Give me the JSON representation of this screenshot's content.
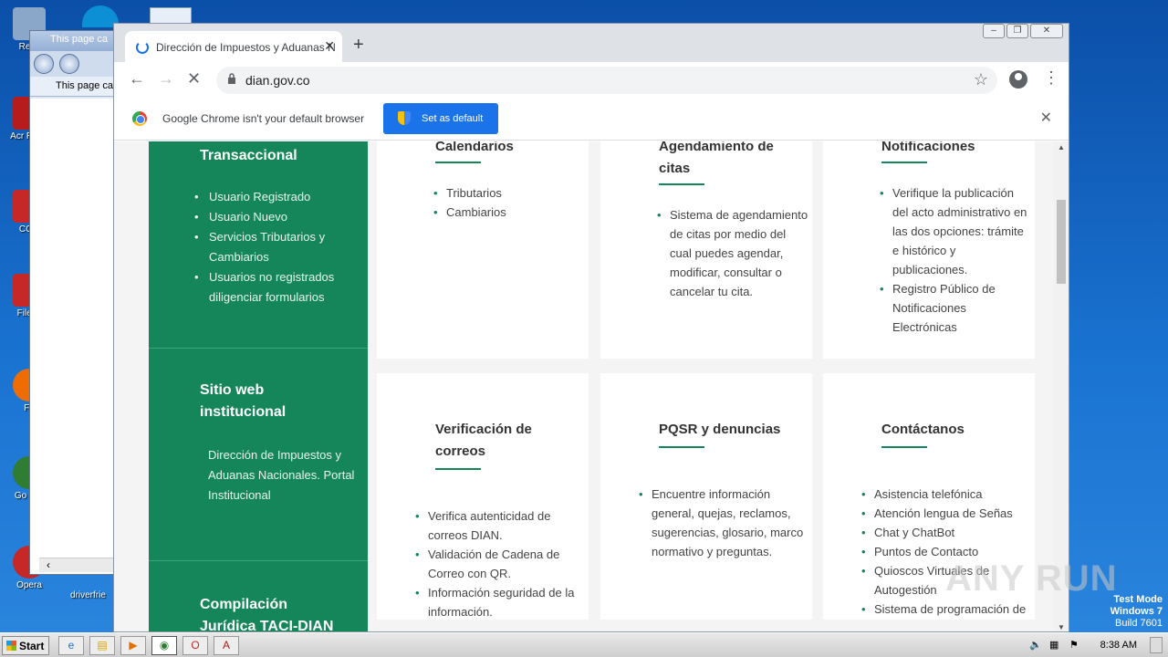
{
  "desktop": {
    "icons": [
      {
        "label": "Recy",
        "color": "#8aa7c9"
      },
      {
        "label": "Acr Read",
        "color": "#b71c1c"
      },
      {
        "label": "CCle",
        "color": "#c62828"
      },
      {
        "label": "FileZil",
        "color": "#c62828"
      },
      {
        "label": "Fir",
        "color": "#ef6c00"
      },
      {
        "label": "Go Chr",
        "color": "#2e7d32"
      },
      {
        "label": "Opera",
        "color": "#c62828"
      }
    ],
    "driver_label": "driverfrie"
  },
  "ie_window": {
    "title": "This page ca",
    "tab": "This page ca"
  },
  "chrome": {
    "tab_title": "Dirección de Impuestos y Aduanas N",
    "url": "dian.gov.co",
    "infobar_text": "Google Chrome isn't your default browser",
    "set_default_label": "Set as default"
  },
  "page": {
    "sections": [
      {
        "title": "Transaccional",
        "items": [
          "Usuario Registrado",
          "Usuario Nuevo",
          "Servicios Tributarios y",
          "Cambiarios",
          "Usuarios no registrados",
          "diligenciar formularios"
        ]
      },
      {
        "title_lines": [
          "Sitio web",
          "institucional"
        ],
        "text": [
          "Dirección de Impuestos y",
          "Aduanas Nacionales. Portal",
          "Institucional"
        ]
      },
      {
        "title_lines": [
          "Compilación",
          "Jurídica TACI-DIAN"
        ]
      }
    ],
    "cards_row1": [
      {
        "title": "Calendarios",
        "items": [
          "Tributarios",
          "Cambiarios"
        ]
      },
      {
        "title_lines": [
          "Agendamiento de",
          "citas"
        ],
        "items": [
          "Sistema de agendamiento de citas por medio del cual puedes agendar, modificar, consultar o cancelar tu cita."
        ]
      },
      {
        "title": "Notificaciones",
        "items": [
          "Verifique la publicación del acto administrativo en las dos opciones: trámite e histórico y publicaciones.",
          "Registro Público de Notificaciones Electrónicas"
        ]
      }
    ],
    "cards_row2": [
      {
        "title_lines": [
          "Verificación de",
          "correos"
        ],
        "items": [
          "Verifica autenticidad de correos DIAN.",
          "Validación de Cadena de Correo con QR.",
          "Información seguridad de la información."
        ]
      },
      {
        "title": "PQSR y denuncias",
        "items": [
          "Encuentre información general, quejas, reclamos, sugerencias, glosario, marco normativo y preguntas."
        ]
      },
      {
        "title": "Contáctanos",
        "items": [
          "Asistencia telefónica",
          "Atención lengua de Señas",
          "Chat y ChatBot",
          "Puntos de Contacto",
          "Quioscos Virtuales de Autogestión",
          "Sistema de programación de llamada"
        ]
      }
    ]
  },
  "taskbar": {
    "start_label": "Start",
    "clock": "8:38 AM"
  },
  "watermark": {
    "line1": "Test Mode",
    "line2": "Windows 7",
    "line3": "Build 7601",
    "brand": "ANY RUN"
  }
}
